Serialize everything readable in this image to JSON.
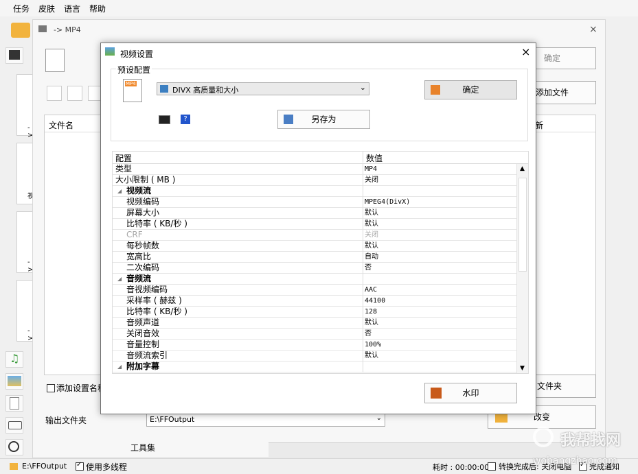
{
  "menu": [
    "任务",
    "皮肤",
    "语言",
    "帮助"
  ],
  "conv_window": {
    "title": "-> MP4",
    "ok_label": "确定",
    "add_file_label": "添加文件",
    "add_folder_label": "添加文件夹",
    "change_label": "改变",
    "file_name_header": "文件名",
    "last_col_header": "新",
    "add_setting_name": "添加设置名称",
    "output_folder_label": "输出文件夹",
    "output_folder_value": "E:\\FFOutput",
    "left_arrow_1": "->",
    "left_arrow_2": "->",
    "left_arrow_3": "->",
    "left_video_label": "视",
    "toolset_label": "工具集"
  },
  "dialog": {
    "title": "视频设置",
    "preset_group": "预设配置",
    "preset_value": "DIVX 高质量和大小",
    "ok_label": "确定",
    "save_as_label": "另存为",
    "watermark_label": "水印",
    "grid_head": {
      "key": "配置",
      "value": "数值"
    },
    "rows": [
      {
        "k": "类型",
        "v": "MP4"
      },
      {
        "k": "大小限制 ( MB )",
        "v": "关闭"
      },
      {
        "k": "视频流",
        "v": ""
      },
      {
        "k": "视频编码",
        "v": "MPEG4(DivX)"
      },
      {
        "k": "屏幕大小",
        "v": "默认"
      },
      {
        "k": "比特率 ( KB/秒 )",
        "v": "默认"
      },
      {
        "k": "CRF",
        "v": "关闭"
      },
      {
        "k": "每秒帧数",
        "v": "默认"
      },
      {
        "k": "宽高比",
        "v": "自动"
      },
      {
        "k": "二次编码",
        "v": "否"
      },
      {
        "k": "音频流",
        "v": ""
      },
      {
        "k": "音视频编码",
        "v": "AAC"
      },
      {
        "k": "采样率 ( 赫兹 )",
        "v": "44100"
      },
      {
        "k": "比特率 ( KB/秒 )",
        "v": "128"
      },
      {
        "k": "音频声道",
        "v": "默认"
      },
      {
        "k": "关闭音效",
        "v": "否"
      },
      {
        "k": "音量控制",
        "v": "100%"
      },
      {
        "k": "音频流索引",
        "v": "默认"
      },
      {
        "k": "附加字幕",
        "v": ""
      }
    ]
  },
  "status": {
    "path": "E:\\FFOutput",
    "multithread": "使用多线程",
    "elapsed": "耗时 : 00:00:00",
    "after_convert": "转换完成后: 关闭电脑",
    "notify": "完成通知"
  },
  "watermark_site": {
    "cn": "我帮找网",
    "url": "wobangzhao.com"
  },
  "colors": {
    "accent_orange": "#e8822a",
    "selection_blue": "#3c7fc1"
  }
}
